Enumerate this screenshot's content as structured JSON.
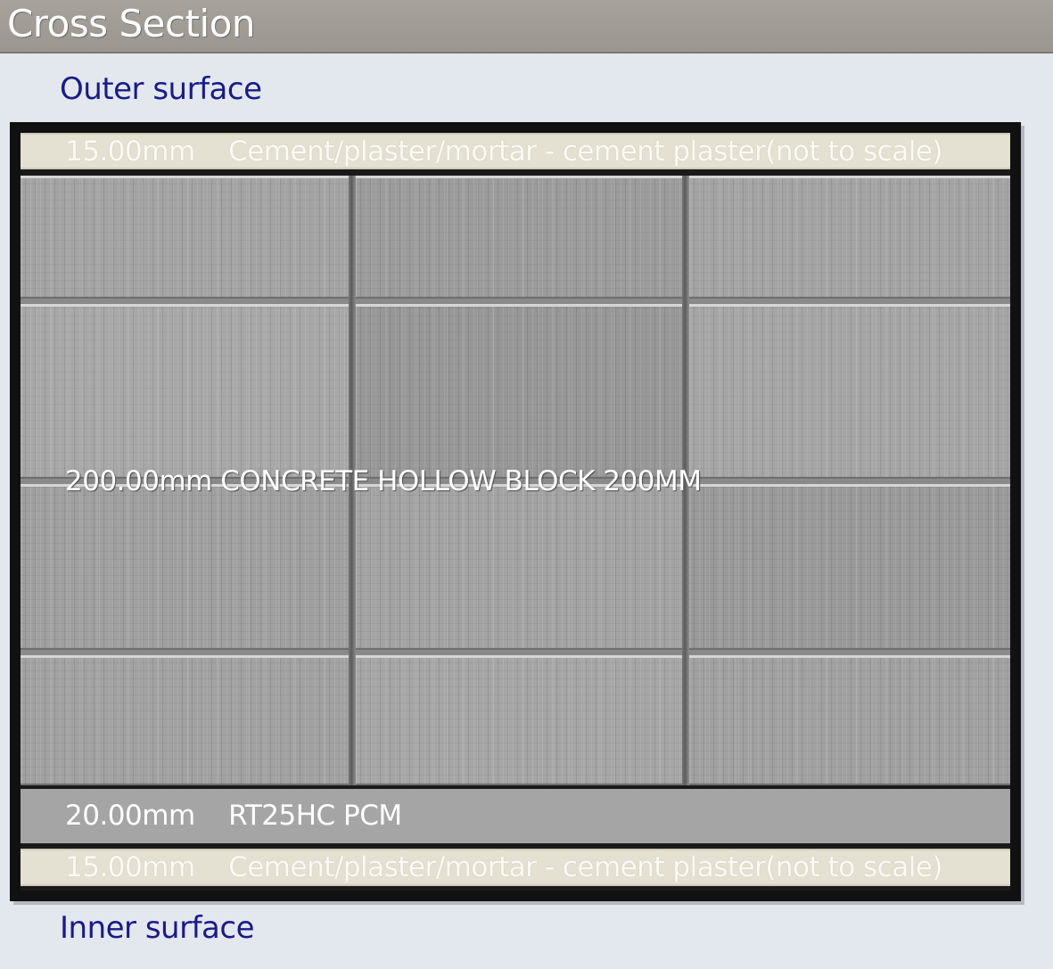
{
  "window": {
    "title": "Cross Section"
  },
  "surfaces": {
    "outer": "Outer surface",
    "inner": "Inner surface"
  },
  "layers": [
    {
      "thickness": "15.00mm",
      "material": "Cement/plaster/mortar - cement plaster(not to scale)"
    },
    {
      "thickness": "200.00mm",
      "material": "CONCRETE HOLLOW BLOCK 200MM"
    },
    {
      "thickness": "20.00mm",
      "material": "RT25HC PCM"
    },
    {
      "thickness": "15.00mm",
      "material": "Cement/plaster/mortar - cement plaster(not to scale)"
    }
  ],
  "colors": {
    "title_bar": "#a29d97",
    "surface_label": "#1a1a8a",
    "plaster_layer": "#e4e1d2",
    "pcm_layer": "#a5a5a5",
    "frame_border": "#111111",
    "panel_background": "#e3e7ee"
  }
}
